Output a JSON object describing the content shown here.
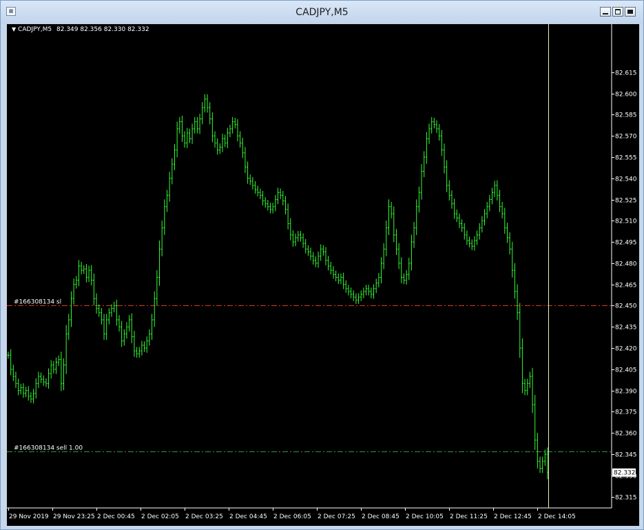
{
  "window": {
    "title": "CADJPY,M5"
  },
  "chart": {
    "header_triangle": "▼",
    "symbol_label": "CADJPY,M5",
    "ohlc_text": "82.349 82.356 82.330 82.332",
    "current_price_label": "82.332",
    "order_lines": [
      {
        "label": "#166308134 sl",
        "price": 82.45,
        "color": "#d83a1e"
      },
      {
        "label": "#166308134 sell 1.00",
        "price": 82.347,
        "color": "#2e9a3c"
      }
    ]
  },
  "chart_data": {
    "type": "line",
    "title": "",
    "xlabel": "",
    "ylabel": "",
    "ylim": [
      82.307,
      82.649
    ],
    "y_ticks": [
      "82.615",
      "82.600",
      "82.585",
      "82.570",
      "82.555",
      "82.540",
      "82.525",
      "82.510",
      "82.495",
      "82.480",
      "82.465",
      "82.450",
      "82.435",
      "82.420",
      "82.405",
      "82.390",
      "82.375",
      "82.360",
      "82.345",
      "82.330",
      "82.315"
    ],
    "x_ticks": [
      "29 Nov 2019",
      "29 Nov 23:25",
      "2 Dec 00:45",
      "2 Dec 02:05",
      "2 Dec 03:25",
      "2 Dec 04:45",
      "2 Dec 06:05",
      "2 Dec 07:25",
      "2 Dec 08:45",
      "2 Dec 10:05",
      "2 Dec 11:25",
      "2 Dec 12:45",
      "2 Dec 14:05"
    ],
    "grid": false,
    "series": [
      {
        "values": [
          82.415,
          82.405,
          82.4,
          82.395,
          82.39,
          82.392,
          82.388,
          82.39,
          82.386,
          82.384,
          82.388,
          82.395,
          82.4,
          82.398,
          82.396,
          82.395,
          82.402,
          82.408,
          82.405,
          82.41,
          82.412,
          82.395,
          82.408,
          82.43,
          82.44,
          82.455,
          82.465,
          82.468,
          82.478,
          82.475,
          82.476,
          82.47,
          82.475,
          82.468,
          82.455,
          82.448,
          82.445,
          82.44,
          82.43,
          82.44,
          82.445,
          82.448,
          82.45,
          82.44,
          82.435,
          82.425,
          82.43,
          82.435,
          82.44,
          82.428,
          82.418,
          82.416,
          82.418,
          82.422,
          82.42,
          82.425,
          82.43,
          82.44,
          82.455,
          82.47,
          82.49,
          82.505,
          82.52,
          82.528,
          82.54,
          82.55,
          82.56,
          82.575,
          82.58,
          82.57,
          82.565,
          82.572,
          82.568,
          82.575,
          82.58,
          82.575,
          82.582,
          82.59,
          82.596,
          82.59,
          82.582,
          82.57,
          82.565,
          82.56,
          82.562,
          82.568,
          82.565,
          82.572,
          82.575,
          82.58,
          82.578,
          82.57,
          82.565,
          82.558,
          82.548,
          82.54,
          82.538,
          82.535,
          82.532,
          82.53,
          82.528,
          82.524,
          82.522,
          82.52,
          82.518,
          82.52,
          82.525,
          82.53,
          82.528,
          82.524,
          82.518,
          82.508,
          82.5,
          82.495,
          82.498,
          82.5,
          82.498,
          82.494,
          82.49,
          82.488,
          82.485,
          82.482,
          82.48,
          82.485,
          82.49,
          82.488,
          82.482,
          82.478,
          82.475,
          82.472,
          82.47,
          82.468,
          82.47,
          82.465,
          82.462,
          82.46,
          82.458,
          82.456,
          82.454,
          82.456,
          82.458,
          82.46,
          82.462,
          82.46,
          82.458,
          82.462,
          82.466,
          82.47,
          82.48,
          82.49,
          82.505,
          82.52,
          82.515,
          82.5,
          82.49,
          82.48,
          82.47,
          82.468,
          82.472,
          82.48,
          82.495,
          82.505,
          82.52,
          82.53,
          82.545,
          82.555,
          82.568,
          82.575,
          82.58,
          82.578,
          82.575,
          82.57,
          82.56,
          82.548,
          82.535,
          82.528,
          82.522,
          82.515,
          82.512,
          82.508,
          82.505,
          82.5,
          82.496,
          82.494,
          82.492,
          82.496,
          82.5,
          82.505,
          82.51,
          82.515,
          82.52,
          82.525,
          82.53,
          82.535,
          82.528,
          82.52,
          82.515,
          82.505,
          82.498,
          82.49,
          82.475,
          82.46,
          82.445,
          82.42,
          82.395,
          82.39,
          82.395,
          82.4,
          82.38,
          82.355,
          82.34,
          82.335,
          82.34,
          82.345,
          82.332
        ]
      }
    ]
  }
}
